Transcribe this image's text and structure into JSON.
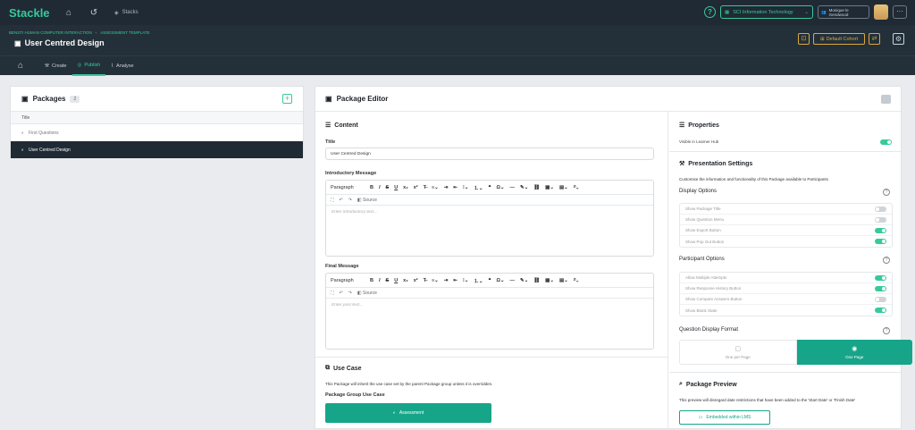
{
  "topbar": {
    "logo": "Stackle",
    "stacks_label": "Stacks",
    "org_label": "SCI Information Technology",
    "user_label": "Monique le Gendwood",
    "more_label": "···"
  },
  "header": {
    "breadcrumb": [
      "BENSTI HUMAN COMPUTER INTERACTION",
      "ASSESSMENT TEMPLATE"
    ],
    "title": "User Centred Design",
    "cohort_label": "Default Cohort"
  },
  "tabs": [
    {
      "label": "Create"
    },
    {
      "label": "Publish"
    },
    {
      "label": "Analyse"
    }
  ],
  "packages": {
    "title": "Packages",
    "count": "2",
    "column": "Title",
    "items": [
      "First Questions",
      "User Centred Design"
    ]
  },
  "editor": {
    "title": "Package Editor",
    "content_title": "Content",
    "title_label": "Title",
    "title_value": "User Centred Design",
    "intro_label": "Introductory Message",
    "intro_placeholder": "Enter introductory text...",
    "final_label": "Final Message",
    "final_placeholder": "Enter post text...",
    "toolbar_paragraph": "Paragraph",
    "toolbar_source": "Source",
    "usecase_title": "Use Case",
    "usecase_note": "This Package will inherit the use case set by the parent Package group unless it is overridden.",
    "usecase_group_label": "Package Group Use Case",
    "usecase_button": "Assessment"
  },
  "properties": {
    "title": "Properties",
    "visible_label": "Visible in Learner Hub",
    "presentation_title": "Presentation Settings",
    "presentation_note": "Customise the information and functionality of this Package available to Participants",
    "display_title": "Display Options",
    "display_options": [
      {
        "label": "Show Package Title",
        "on": false
      },
      {
        "label": "Show Question Menu",
        "on": false
      },
      {
        "label": "Show Export Button",
        "on": true
      },
      {
        "label": "Show Pop Out Button",
        "on": true
      }
    ],
    "participant_title": "Participant Options",
    "participant_options": [
      {
        "label": "Allow Multiple Attempts",
        "on": true
      },
      {
        "label": "Show Response History Button",
        "on": true
      },
      {
        "label": "Show Compare Answers Button",
        "on": false
      },
      {
        "label": "Show Blank State",
        "on": true
      }
    ],
    "format_title": "Question Display Format",
    "format_each": "One per Page",
    "format_one": "One Page",
    "preview_title": "Package Preview",
    "preview_note": "This preview will disregard date restrictions that have been added to the 'Start Date' or 'Finish Date'",
    "preview_button": "Embedded within LMS"
  },
  "colors": {
    "accent": "#38c99a",
    "dark": "#1f2a35",
    "gold": "#d9a93a"
  }
}
